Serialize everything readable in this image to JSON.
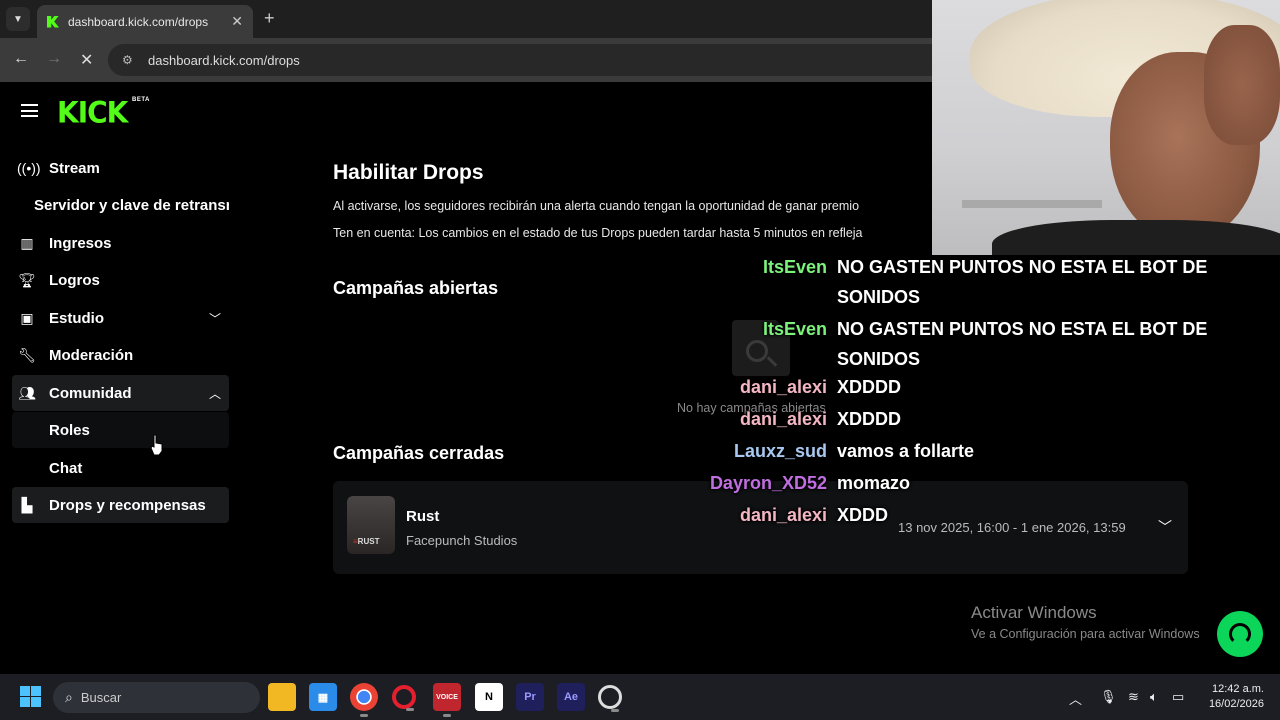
{
  "browser": {
    "tab_title": "dashboard.kick.com/drops",
    "url": "dashboard.kick.com/drops",
    "tab_close": "✕",
    "new_tab": "+"
  },
  "brand": {
    "logo_text": "KICK",
    "logo_badge": "BETA",
    "accent_color": "#53fc18"
  },
  "sidebar": {
    "items": [
      {
        "label": "Stream",
        "icon": "broadcast-icon"
      },
      {
        "label": "Servidor y clave de retransm"
      },
      {
        "label": "Ingresos",
        "icon": "bar-chart-icon"
      },
      {
        "label": "Logros",
        "icon": "trophy-icon"
      },
      {
        "label": "Estudio",
        "icon": "film-icon"
      },
      {
        "label": "Moderación",
        "icon": "wrench-icon"
      },
      {
        "label": "Comunidad",
        "icon": "users-icon"
      },
      {
        "label": "Roles"
      },
      {
        "label": "Chat"
      },
      {
        "label": "Drops y recompensas",
        "icon": "drops-icon"
      }
    ]
  },
  "main": {
    "title": "Habilitar Drops",
    "description_1": "Al activarse, los seguidores recibirán una alerta cuando tengan la oportunidad de ganar premio",
    "description_2": "Ten en cuenta: Los cambios en el estado de tus Drops pueden tardar hasta 5 minutos en refleja",
    "open_campaigns_title": "Campañas abiertas",
    "open_campaigns_empty": "No hay campañas abiertas",
    "closed_campaigns_title": "Campañas cerradas",
    "closed_campaigns": [
      {
        "game": "Rust",
        "developer": "Facepunch Studios",
        "dates": "13 nov 2025, 16:00 - 1 ene 2026, 13:59",
        "thumb_badge_prefix": "≡",
        "thumb_badge": "RUST"
      }
    ]
  },
  "chat_overlay": [
    {
      "user": "ItsEven",
      "message": "NO GASTEN PUNTOS NO ESTA EL BOT DE SONIDOS",
      "color": "#7cf27c"
    },
    {
      "user": "ItsEven",
      "message": "NO GASTEN PUNTOS NO ESTA EL BOT DE SONIDOS",
      "color": "#7cf27c"
    },
    {
      "user": "dani_alexi",
      "message": "XDDDD",
      "color": "#f4b6c2"
    },
    {
      "user": "dani_alexi",
      "message": "XDDDD",
      "color": "#f4b6c2"
    },
    {
      "user": "Lauxz_sud",
      "message": "vamos a follarte",
      "color": "#a8c8f0"
    },
    {
      "user": "Dayron_XD52",
      "message": "momazo",
      "color": "#c06ee0"
    },
    {
      "user": "dani_alexi",
      "message": "XDDD",
      "color": "#f4b6c2"
    }
  ],
  "windows_activation": {
    "title": "Activar Windows",
    "subtitle": "Ve a Configuración para activar Windows"
  },
  "taskbar": {
    "search_placeholder": "Buscar",
    "apps": [
      {
        "name": "file-explorer-icon",
        "label": ""
      },
      {
        "name": "microsoft-store-icon",
        "label": ""
      },
      {
        "name": "chrome-icon",
        "label": ""
      },
      {
        "name": "opera-icon",
        "label": ""
      },
      {
        "name": "voicemeeter-icon",
        "label": "VOICE"
      },
      {
        "name": "notion-icon",
        "label": "N"
      },
      {
        "name": "premiere-pro-icon",
        "label": "Pr"
      },
      {
        "name": "after-effects-icon",
        "label": "Ae"
      },
      {
        "name": "obs-icon",
        "label": ""
      }
    ],
    "time": "12:42 a.m.",
    "date": "16/02/2026"
  }
}
